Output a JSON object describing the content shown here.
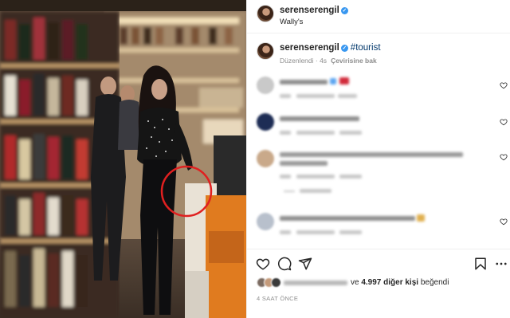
{
  "post": {
    "username": "serenserengil",
    "location": "Wally's"
  },
  "caption": {
    "username": "serenserengil",
    "hashtag": "#tourist",
    "edited": "Düzenlendi · 4s",
    "translate": "Çevirisine bak"
  },
  "actions": {
    "likes_prefix": "ve",
    "likes_count": "4.997 diğer kişi",
    "likes_suffix": "beğendi",
    "timestamp": "4 SAAT ÖNCE"
  },
  "colors": {
    "verified": "#3897f0",
    "hashtag": "#00376b",
    "highlight_circle": "#e02020",
    "muted_text": "#8e8e8e"
  },
  "icons": [
    "verified-icon",
    "heart-icon",
    "comment-icon",
    "share-icon",
    "bookmark-icon",
    "more-options-icon"
  ]
}
